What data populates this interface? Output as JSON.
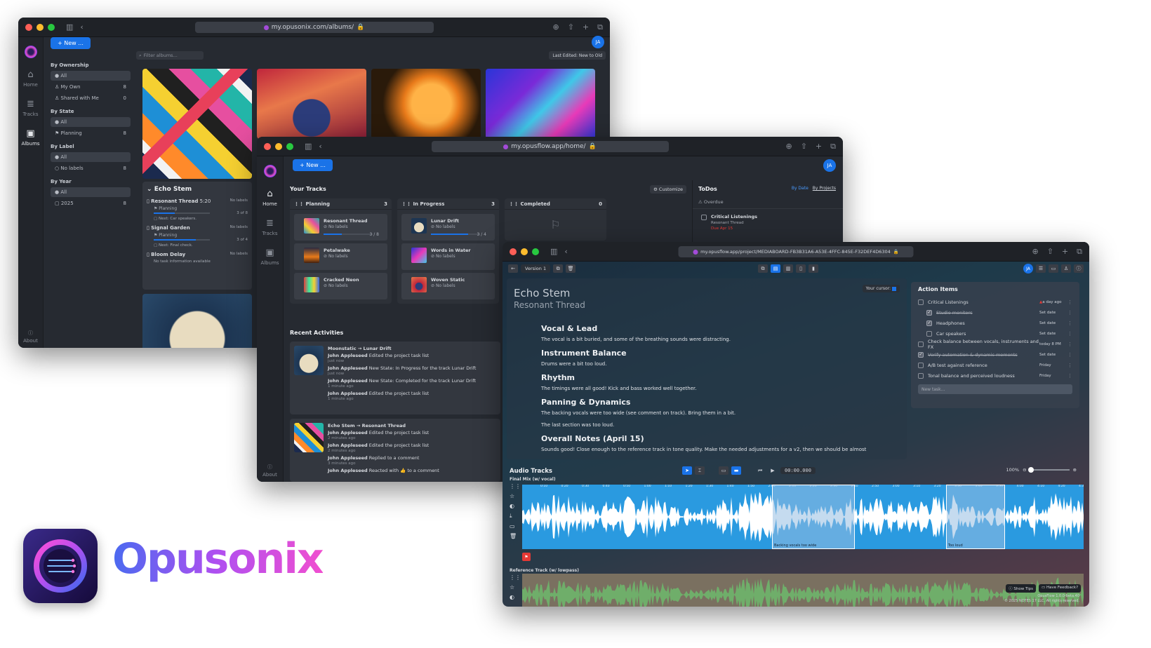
{
  "brand": {
    "name": "Opusonix"
  },
  "win1": {
    "url": "my.opusonix.com/albums/",
    "new_button": "New ...",
    "avatar": "JA",
    "rail": [
      {
        "label": "Home",
        "icon": "home-icon"
      },
      {
        "label": "Tracks",
        "icon": "tracks-icon"
      },
      {
        "label": "Albums",
        "icon": "albums-icon"
      }
    ],
    "about": "About",
    "filter_placeholder": "Filter albums...",
    "sort": "Last Edited: New to Old",
    "filters": {
      "ownership": {
        "title": "By Ownership",
        "items": [
          {
            "label": "All",
            "count": ""
          },
          {
            "label": "My Own",
            "count": "8"
          },
          {
            "label": "Shared with Me",
            "count": "0"
          }
        ]
      },
      "state": {
        "title": "By State",
        "items": [
          {
            "label": "All",
            "count": ""
          },
          {
            "label": "Planning",
            "count": "8"
          }
        ]
      },
      "label": {
        "title": "By Label",
        "items": [
          {
            "label": "All",
            "count": ""
          },
          {
            "label": "No labels",
            "count": "8"
          }
        ]
      },
      "year": {
        "title": "By Year",
        "items": [
          {
            "label": "All",
            "count": ""
          },
          {
            "label": "2025",
            "count": "8"
          }
        ]
      }
    },
    "album": {
      "title": "Echo Stem",
      "tracks": [
        {
          "name": "Resonant Thread",
          "dur": "5:20",
          "labels": "No labels",
          "state": "Planning",
          "count": "3 of 8",
          "next": "Next: Car speakers."
        },
        {
          "name": "Signal Garden",
          "dur": "",
          "labels": "No labels",
          "state": "Planning",
          "count": "3 of 4",
          "next": "Next: Final check."
        },
        {
          "name": "Bloom Delay",
          "dur": "",
          "labels": "No labels",
          "state": "",
          "count": "",
          "next": "No task information available"
        }
      ]
    }
  },
  "win2": {
    "url": "my.opusflow.app/home/",
    "new_button": "New ...",
    "avatar": "JA",
    "rail": [
      {
        "label": "Home",
        "icon": "home-icon"
      },
      {
        "label": "Tracks",
        "icon": "tracks-icon"
      },
      {
        "label": "Albums",
        "icon": "albums-icon"
      }
    ],
    "about": "About",
    "your_tracks": "Your Tracks",
    "customize": "Customize",
    "columns": [
      {
        "title": "Planning",
        "count": "3",
        "cards": [
          {
            "name": "Resonant Thread",
            "labels": "No labels",
            "count": "3 / 8",
            "progress": 0.375
          },
          {
            "name": "Petalwake",
            "labels": "No labels"
          },
          {
            "name": "Cracked Neon",
            "labels": "No labels"
          }
        ]
      },
      {
        "title": "In Progress",
        "count": "3",
        "cards": [
          {
            "name": "Lunar Drift",
            "labels": "No labels",
            "count": "3 / 4",
            "progress": 0.75
          },
          {
            "name": "Words in Water",
            "labels": "No labels"
          },
          {
            "name": "Woven Static",
            "labels": "No labels"
          }
        ]
      },
      {
        "title": "Completed",
        "count": "0",
        "cards": []
      }
    ],
    "todos": {
      "title": "ToDos",
      "by_date": "By Date",
      "by_projects": "By Projects",
      "overdue": "Overdue",
      "item": "Critical Listenings",
      "item_track": "Resonant Thread",
      "item_due": "Due Apr 15"
    },
    "recent_title": "Recent Activities",
    "activities": [
      {
        "title": "Moonstatic → Lunar Drift",
        "lines": [
          {
            "who": "John Appleseed",
            "what": "Edited the project task list",
            "when": "just now"
          },
          {
            "who": "John Appleseed",
            "what": "New State: In Progress for the track Lunar Drift",
            "when": "just now"
          },
          {
            "who": "John Appleseed",
            "what": "New State: Completed for the track Lunar Drift",
            "when": "1 minute ago"
          },
          {
            "who": "John Appleseed",
            "what": "Edited the project task list",
            "when": "1 minute ago"
          }
        ]
      },
      {
        "title": "Echo Stem → Resonant Thread",
        "lines": [
          {
            "who": "John Appleseed",
            "what": "Edited the project task list",
            "when": "2 minutes ago"
          },
          {
            "who": "John Appleseed",
            "what": "Edited the project task list",
            "when": "2 minutes ago"
          },
          {
            "who": "John Appleseed",
            "what": "Replied to a comment",
            "when": "3 minutes ago"
          },
          {
            "who": "John Appleseed",
            "what": "Reacted with 👍 to a comment",
            "when": ""
          }
        ]
      }
    ]
  },
  "win3": {
    "url": "my.opusflow.app/project/MEDIABOARD-FB3B31A6-A53E-4FFC-845E-F32DEF4D6304",
    "version": "Version 1",
    "avatar": "JA",
    "album": "Echo Stem",
    "track": "Resonant Thread",
    "your_cursor": "Your cursor:",
    "notes": [
      {
        "heading": "Vocal & Lead",
        "text": [
          "The vocal is a bit buried, and some of the breathing sounds were distracting."
        ]
      },
      {
        "heading": "Instrument Balance",
        "text": [
          "Drums were a bit too loud."
        ]
      },
      {
        "heading": "Rhythm",
        "text": [
          "The timings were all good! Kick and bass worked well together."
        ]
      },
      {
        "heading": "Panning & Dynamics",
        "text": [
          "The backing vocals were too wide (see comment on track). Bring them in a bit.",
          "The last section was too loud."
        ]
      },
      {
        "heading": "Overall Notes (April 15)",
        "text": [
          "Sounds good! Close enough to the reference track in tone quality. Make the needed adjustments for a v2, then we should be almost"
        ]
      }
    ],
    "action_items": {
      "title": "Action Items",
      "items": [
        {
          "label": "Critical Listenings",
          "checked": false,
          "indent": false,
          "date": "a day ago",
          "overdue": true
        },
        {
          "label": "Studio monitors",
          "checked": true,
          "indent": true,
          "date": "Set date",
          "strike": true
        },
        {
          "label": "Headphones",
          "checked": true,
          "indent": true,
          "date": "Set date"
        },
        {
          "label": "Car speakers",
          "checked": false,
          "indent": true,
          "date": "Set date"
        },
        {
          "label": "Check balance between vocals, instruments and FX",
          "checked": false,
          "indent": false,
          "date": "today 8 PM"
        },
        {
          "label": "Verify automation & dynamic moments",
          "checked": true,
          "indent": false,
          "date": "Set date",
          "strike": true
        },
        {
          "label": "A/B test against reference",
          "checked": false,
          "indent": false,
          "date": "Friday"
        },
        {
          "label": "Tonal balance and perceived loudness",
          "checked": false,
          "indent": false,
          "date": "Friday"
        }
      ],
      "new_task_placeholder": "New task..."
    },
    "audio": {
      "title": "Audio Tracks",
      "time": "00:00.000",
      "zoom": "100%",
      "track1": "Final Mix (w/ vocal)",
      "track2": "Reference Track (w/ lowpass)",
      "region1": "Backing vocals too wide",
      "region2": "Too loud",
      "ruler": [
        "0:10",
        "0:20",
        "0:30",
        "0:40",
        "0:50",
        "1:00",
        "1:10",
        "1:20",
        "1:30",
        "1:40",
        "1:50",
        "2:00",
        "2:10",
        "2:20",
        "2:30",
        "2:40",
        "2:50",
        "3:00",
        "3:10",
        "3:20",
        "3:30",
        "3:40",
        "3:50",
        "4:00",
        "4:10",
        "4:20",
        "4:30"
      ]
    },
    "show_tips": "Show Tips",
    "feedback": "Have Feedback?",
    "footer1": "OpusFlow 1.0.0-beta.40",
    "footer2": "© 2025 NOTES 17 LLC. All rights reserved."
  }
}
